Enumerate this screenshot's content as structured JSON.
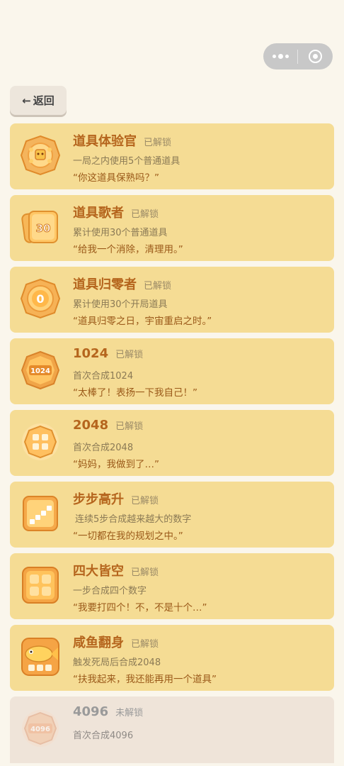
{
  "header": {
    "back_label": "返回",
    "back_arrow": "←"
  },
  "capsule": {
    "more_icon": "more-dots-icon",
    "close_icon": "target-circle-icon"
  },
  "achievements": [
    {
      "title": "道具体验官",
      "status": "已解锁",
      "desc": "一局之内使用5个普通道具",
      "quote": "“你这道具保熟吗？”",
      "icon": "tool-badge-icon",
      "icon_text": "",
      "locked": false
    },
    {
      "title": "道具歌者",
      "status": "已解锁",
      "desc": "累计使用30个普通道具",
      "quote": "“给我一个消除，清理用。”",
      "icon": "cards-30-icon",
      "icon_text": "30",
      "locked": false
    },
    {
      "title": "道具归零者",
      "status": "已解锁",
      "desc": "累计使用30个开局道具",
      "quote": "“道具归零之日，宇宙重启之时。”",
      "icon": "zero-badge-icon",
      "icon_text": "0",
      "locked": false
    },
    {
      "title": "1024",
      "status": "已解锁",
      "desc": "首次合成1024",
      "quote": "“太棒了！表扬一下我自己！”",
      "icon": "badge-1024-icon",
      "icon_text": "1024",
      "locked": false
    },
    {
      "title": "2048",
      "status": "已解锁",
      "desc": "首次合成2048",
      "quote": "“妈妈，我做到了…”",
      "icon": "badge-2048-icon",
      "icon_text": "",
      "locked": false
    },
    {
      "title": "步步高升",
      "status": "已解锁",
      "desc": "连续5步合成越来越大的数字",
      "quote": "“一切都在我的规划之中。”",
      "icon": "stairs-icon",
      "icon_text": "",
      "locked": false
    },
    {
      "title": "四大皆空",
      "status": "已解锁",
      "desc": "一步合成四个数字",
      "quote": "“我要打四个！不，不是十个…”",
      "icon": "four-tiles-icon",
      "icon_text": "",
      "locked": false
    },
    {
      "title": "咸鱼翻身",
      "status": "已解锁",
      "desc": "触发死局后合成2048",
      "quote": "“扶我起来，我还能再用一个道具”",
      "icon": "salted-fish-icon",
      "icon_text": "",
      "locked": false
    },
    {
      "title": "4096",
      "status": "未解锁",
      "desc": "首次合成4096",
      "quote": "",
      "icon": "badge-4096-icon",
      "icon_text": "4096",
      "locked": true
    }
  ]
}
